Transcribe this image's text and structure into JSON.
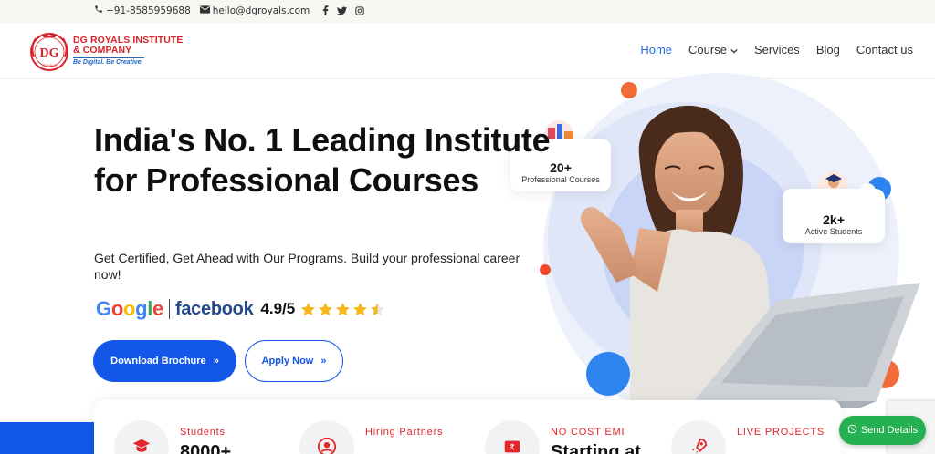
{
  "topbar": {
    "phone": "+91-8585959688",
    "email": "hello@dgroyals.com",
    "social": [
      "facebook-icon",
      "twitter-icon",
      "instagram-icon"
    ]
  },
  "brand": {
    "name_line1": "DG ROYALS INSTITUTE",
    "name_line2": "& COMPANY",
    "tagline": "Be Digital. Be Creative",
    "logo_text": "DG",
    "logo_small": "ROYALS",
    "colors": {
      "red": "#d8232a",
      "blue": "#2266c4"
    }
  },
  "nav": {
    "items": [
      {
        "label": "Home",
        "active": true
      },
      {
        "label": "Course",
        "has_dropdown": true
      },
      {
        "label": "Services"
      },
      {
        "label": "Blog"
      },
      {
        "label": "Contact us"
      }
    ]
  },
  "hero": {
    "title": "India's No. 1 Leading Institute for Professional Courses",
    "subtitle": "Get Certified, Get Ahead with Our Programs. Build your professional career now!",
    "rating_google": "Google",
    "rating_facebook": "facebook",
    "rating_score": "4.9/5",
    "stars": 4.5,
    "primary_button": "Download Brochure",
    "secondary_button": "Apply Now",
    "accent": "#1357e8"
  },
  "cards": {
    "courses_num": "20+",
    "courses_label": "Professional Courses",
    "students_num": "2k+",
    "students_label": "Active Students"
  },
  "stats": [
    {
      "label": "Students",
      "value": "8000+",
      "icon": "graduate-icon"
    },
    {
      "label": "Hiring Partners",
      "value": "",
      "icon": "user-icon"
    },
    {
      "label": "NO COST EMI",
      "value": "Starting at",
      "icon": "rupee-icon"
    },
    {
      "label": "LIVE PROJECTS",
      "value": "",
      "icon": "rocket-icon"
    }
  ],
  "widget": {
    "send_details": "Send Details",
    "color": "#25b152"
  }
}
